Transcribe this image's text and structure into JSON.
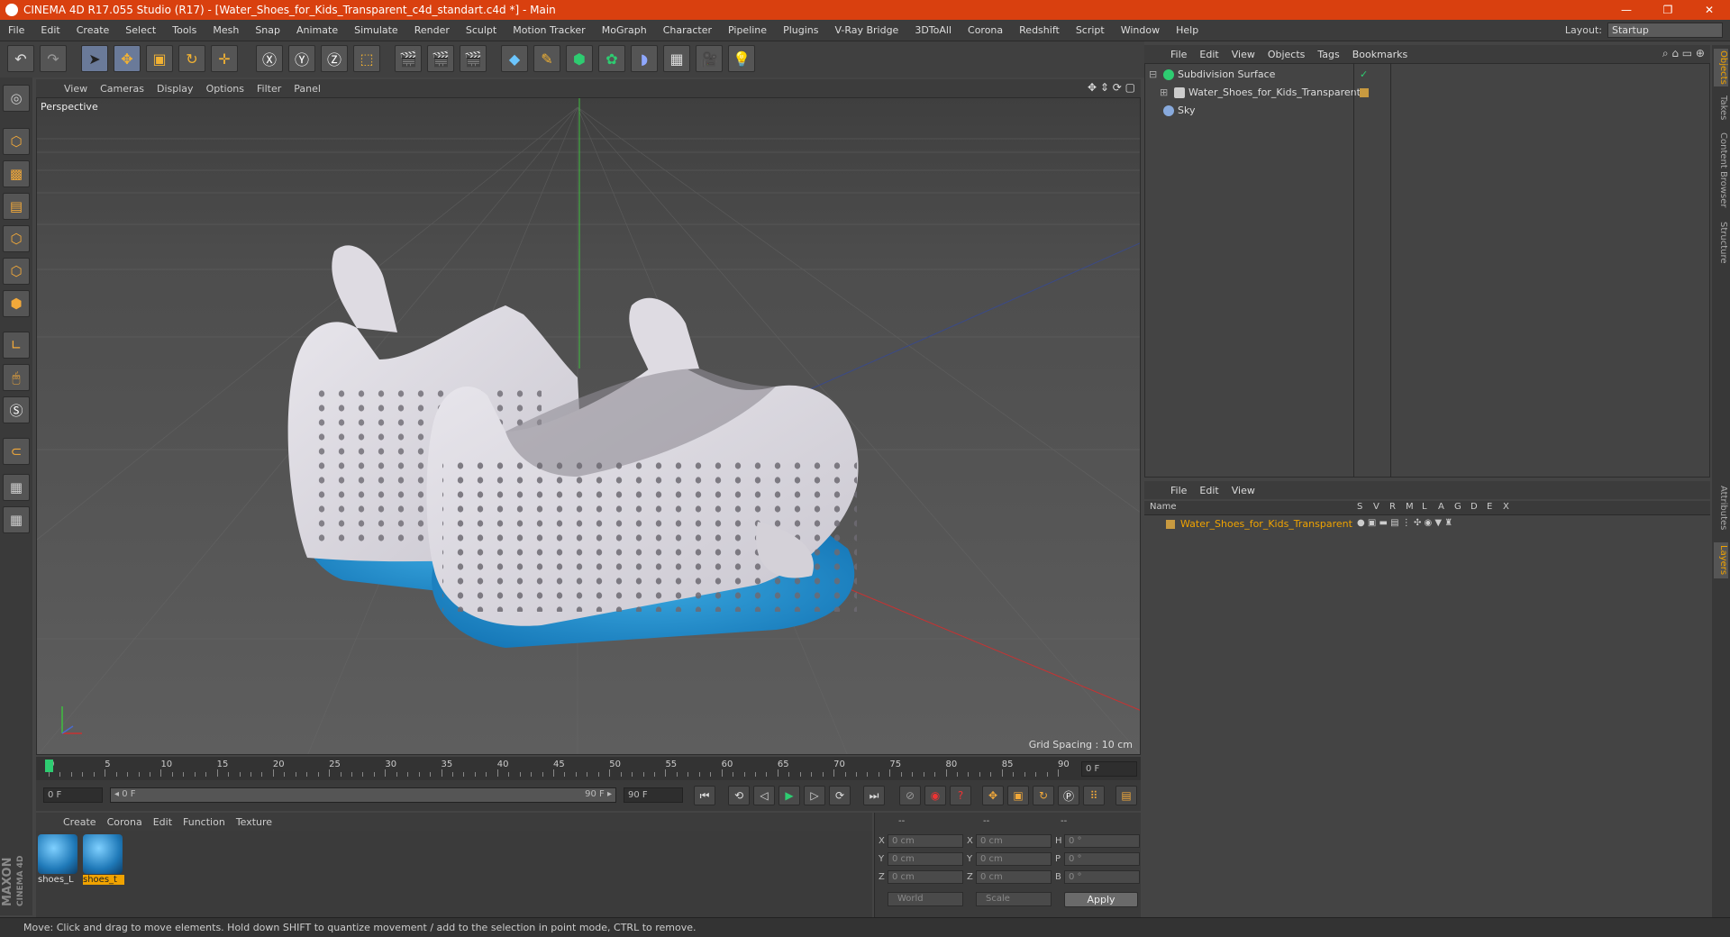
{
  "titlebar": {
    "title": "CINEMA 4D R17.055 Studio (R17) - [Water_Shoes_for_Kids_Transparent_c4d_standart.c4d *] - Main",
    "minimize": "—",
    "restore": "❐",
    "close": "✕"
  },
  "menu": [
    "File",
    "Edit",
    "Create",
    "Select",
    "Tools",
    "Mesh",
    "Snap",
    "Animate",
    "Simulate",
    "Render",
    "Sculpt",
    "Motion Tracker",
    "MoGraph",
    "Character",
    "Pipeline",
    "Plugins",
    "V-Ray Bridge",
    "3DToAll",
    "Corona",
    "Redshift",
    "Script",
    "Window",
    "Help"
  ],
  "layout": {
    "label": "Layout:",
    "value": "Startup"
  },
  "viewport": {
    "menu": [
      "View",
      "Cameras",
      "Display",
      "Options",
      "Filter",
      "Panel"
    ],
    "label": "Perspective",
    "grid_spacing": "Grid Spacing : 10 cm"
  },
  "timeline": {
    "ticks": [
      "0",
      "5",
      "10",
      "15",
      "20",
      "25",
      "30",
      "35",
      "40",
      "45",
      "50",
      "55",
      "60",
      "65",
      "70",
      "75",
      "80",
      "85",
      "90"
    ],
    "current_frame": "0 F",
    "start": "0 F",
    "range_start": "◂ 0 F",
    "range_end": "90 F ▸",
    "end": "90 F"
  },
  "materials": {
    "menu": [
      "Create",
      "Corona",
      "Edit",
      "Function",
      "Texture"
    ],
    "items": [
      {
        "name": "shoes_L"
      },
      {
        "name": "shoes_t"
      }
    ]
  },
  "coordinates": {
    "headers": [
      "--",
      "--",
      "--"
    ],
    "rows": [
      {
        "a": "X",
        "av": "0 cm",
        "b": "X",
        "bv": "0 cm",
        "c": "H",
        "cv": "0 °"
      },
      {
        "a": "Y",
        "av": "0 cm",
        "b": "Y",
        "bv": "0 cm",
        "c": "P",
        "cv": "0 °"
      },
      {
        "a": "Z",
        "av": "0 cm",
        "b": "Z",
        "bv": "0 cm",
        "c": "B",
        "cv": "0 °"
      }
    ],
    "space": "World",
    "mode": "Scale",
    "apply": "Apply"
  },
  "objects": {
    "menu": [
      "File",
      "Edit",
      "View",
      "Objects",
      "Tags",
      "Bookmarks"
    ],
    "items": [
      {
        "name": "Subdivision Surface",
        "color": "#2ecc71"
      },
      {
        "name": "Water_Shoes_for_Kids_Transparent",
        "color": "#cccccc"
      },
      {
        "name": "Sky",
        "color": "#88aadd"
      }
    ]
  },
  "layers": {
    "menu": [
      "File",
      "Edit",
      "View"
    ],
    "columns": [
      "Name",
      "S",
      "V",
      "R",
      "M",
      "L",
      "A",
      "G",
      "D",
      "E",
      "X"
    ],
    "items": [
      {
        "name": "Water_Shoes_for_Kids_Transparent"
      }
    ]
  },
  "side_tabs": [
    "Objects",
    "Takes",
    "Content Browser",
    "Structure",
    "Attributes",
    "Layers"
  ],
  "logo": {
    "line1": "MAXON",
    "line2": "CINEMA 4D"
  },
  "status": "Move: Click and drag to move elements. Hold down SHIFT to quantize movement / add to the selection in point mode, CTRL to remove."
}
